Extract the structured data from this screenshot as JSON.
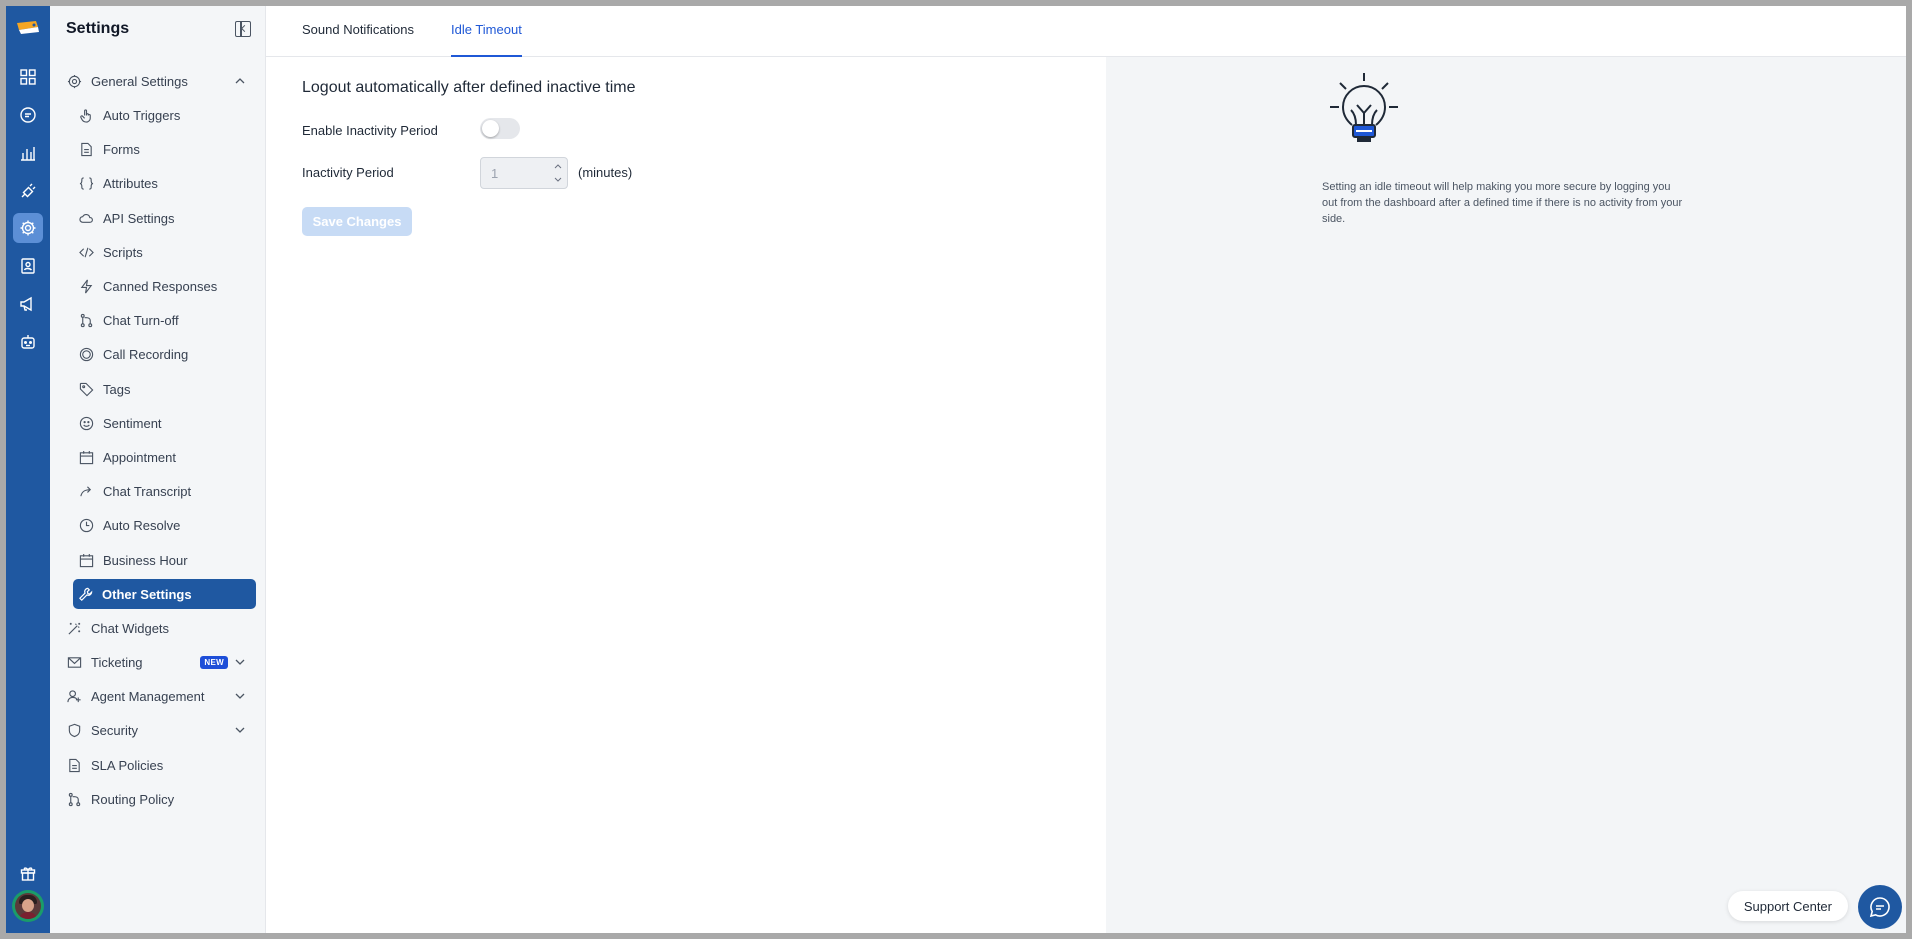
{
  "sidebar": {
    "title": "Settings",
    "items": [
      {
        "label": "General Settings",
        "icon": "gear-icon",
        "level": "top",
        "expanded": true
      },
      {
        "label": "Auto Triggers",
        "icon": "hand-pointer-icon",
        "level": "sub"
      },
      {
        "label": "Forms",
        "icon": "document-icon",
        "level": "sub"
      },
      {
        "label": "Attributes",
        "icon": "braces-icon",
        "level": "sub"
      },
      {
        "label": "API Settings",
        "icon": "cloud-icon",
        "level": "sub"
      },
      {
        "label": "Scripts",
        "icon": "code-icon",
        "level": "sub"
      },
      {
        "label": "Canned Responses",
        "icon": "lightning-icon",
        "level": "sub"
      },
      {
        "label": "Chat Turn-off",
        "icon": "branch-icon",
        "level": "sub"
      },
      {
        "label": "Call Recording",
        "icon": "record-icon",
        "level": "sub"
      },
      {
        "label": "Tags",
        "icon": "tag-icon",
        "level": "sub"
      },
      {
        "label": "Sentiment",
        "icon": "smile-icon",
        "level": "sub"
      },
      {
        "label": "Appointment",
        "icon": "calendar-icon",
        "level": "sub"
      },
      {
        "label": "Chat Transcript",
        "icon": "share-arrow-icon",
        "level": "sub"
      },
      {
        "label": "Auto Resolve",
        "icon": "clock-icon",
        "level": "sub"
      },
      {
        "label": "Business Hour",
        "icon": "calendar-icon",
        "level": "sub"
      },
      {
        "label": "Other Settings",
        "icon": "wrench-icon",
        "level": "sub",
        "active": true
      },
      {
        "label": "Chat Widgets",
        "icon": "magic-wand-icon",
        "level": "top"
      },
      {
        "label": "Ticketing",
        "icon": "envelope-icon",
        "level": "top",
        "badge": "NEW"
      },
      {
        "label": "Agent Management",
        "icon": "user-plus-icon",
        "level": "top"
      },
      {
        "label": "Security",
        "icon": "shield-icon",
        "level": "top"
      },
      {
        "label": "SLA Policies",
        "icon": "document-icon",
        "level": "top"
      },
      {
        "label": "Routing Policy",
        "icon": "branch-icon",
        "level": "top"
      }
    ]
  },
  "tabs": [
    {
      "label": "Sound Notifications",
      "active": false
    },
    {
      "label": "Idle Timeout",
      "active": true
    }
  ],
  "content": {
    "heading": "Logout automatically after defined inactive time",
    "enable_label": "Enable Inactivity Period",
    "enable_value": false,
    "period_label": "Inactivity Period",
    "period_value": "1",
    "period_unit": "(minutes)",
    "save_label": "Save Changes"
  },
  "info": {
    "text": "Setting an idle timeout will help making you more secure by logging you out from the dashboard after a defined time if there is no activity from your side."
  },
  "support": {
    "label": "Support Center"
  },
  "colors": {
    "brand": "#1f58a1",
    "active_tab": "#1f58d6"
  }
}
